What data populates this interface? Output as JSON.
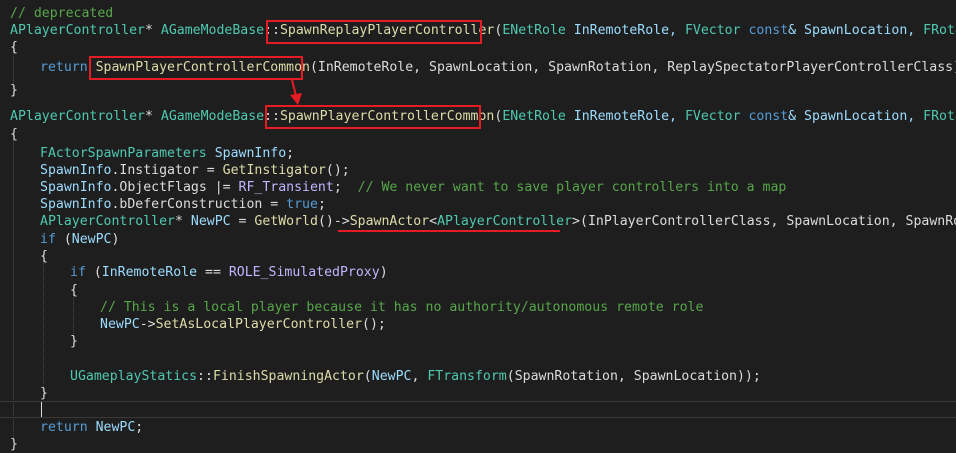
{
  "code": {
    "comment_deprecated": "// deprecated",
    "sig1": {
      "ret_type": "APlayerController",
      "ptr": "* ",
      "class_scope": "AGameModeBase",
      "sep": "::",
      "func": "SpawnReplayPlayerController",
      "open": "(",
      "p1_type": "ENetRole",
      "p1_name": " InRemoteRole, ",
      "p2_type": "FVector",
      "sp": " ",
      "const_kw": "const",
      "p2_rest": "& SpawnLocation, ",
      "p3_type": "FRotator"
    },
    "brace_open": "{",
    "brace_close": "}",
    "line_return1": {
      "kw": "return",
      "func": "SpawnPlayerControllerCommon",
      "args": "(InRemoteRole, SpawnLocation, SpawnRotation, ReplaySpectatorPlayerControllerClass);"
    },
    "sig2": {
      "ret_type": "APlayerController",
      "ptr": "* ",
      "class_scope": "AGameModeBase",
      "sep": "::",
      "func": "SpawnPlayerControllerCommon",
      "open": "(",
      "p1_type": "ENetRole",
      "p1_name": " InRemoteRole, ",
      "p2_type": "FVector",
      "sp": " ",
      "const_kw": "const",
      "p2_rest": "& SpawnLocation, ",
      "p3_type": "FRotator"
    },
    "l_params": {
      "type": "FActorSpawnParameters",
      "name": "SpawnInfo",
      "end": ";"
    },
    "l_instigator": {
      "obj": "SpawnInfo",
      "dot": ".",
      "member": "Instigator",
      "eq": " = ",
      "func": "GetInstigator",
      "end": "();"
    },
    "l_flags": {
      "obj": "SpawnInfo",
      "dot": ".",
      "member": "ObjectFlags",
      "op": " |= ",
      "macro": "RF_Transient",
      "end": ";  ",
      "comment": "// We never want to save player controllers into a map"
    },
    "l_defer": {
      "obj": "SpawnInfo",
      "dot": ".",
      "member": "bDeferConstruction",
      "eq": " = ",
      "val": "true",
      "end": ";"
    },
    "l_newpc": {
      "type": "APlayerController",
      "ptr": "* ",
      "name": "NewPC",
      "eq": " = ",
      "func": "GetWorld",
      "call": "()->",
      "spawn": "SpawnActor",
      "lt": "<",
      "tmpl": "APlayerController",
      "gt": ">",
      "args": "(InPlayerControllerClass, SpawnLocation, SpawnRotati"
    },
    "l_if1": {
      "kw": "if",
      "open": " (",
      "var": "NewPC",
      "close": ")"
    },
    "l_if2": {
      "kw": "if",
      "open": " (",
      "var": "InRemoteRole",
      "op": " == ",
      "macro": "ROLE_SimulatedProxy",
      "close": ")"
    },
    "comment_local": "// This is a local player because it has no authority/autonomous remote role",
    "l_setlocal": {
      "var": "NewPC",
      "arrow": "->",
      "func": "SetAsLocalPlayerController",
      "end": "();"
    },
    "l_finish": {
      "type": "UGameplayStatics",
      "sep": "::",
      "func": "FinishSpawningActor",
      "open": "(",
      "var": "NewPC",
      "comma": ", ",
      "ttype": "FTransform",
      "args": "(SpawnRotation, SpawnLocation));"
    },
    "l_return2": {
      "kw": "return",
      "sp": " ",
      "var": "NewPC",
      "end": ";"
    }
  },
  "colors": {
    "background": "#1e1e1e",
    "keyword": "#569cd6",
    "type": "#4ec9b0",
    "function": "#dcdcaa",
    "parameter": "#9cdcfe",
    "comment": "#57a64a",
    "macro": "#beb7ff",
    "annotation_red": "#e51c23"
  }
}
